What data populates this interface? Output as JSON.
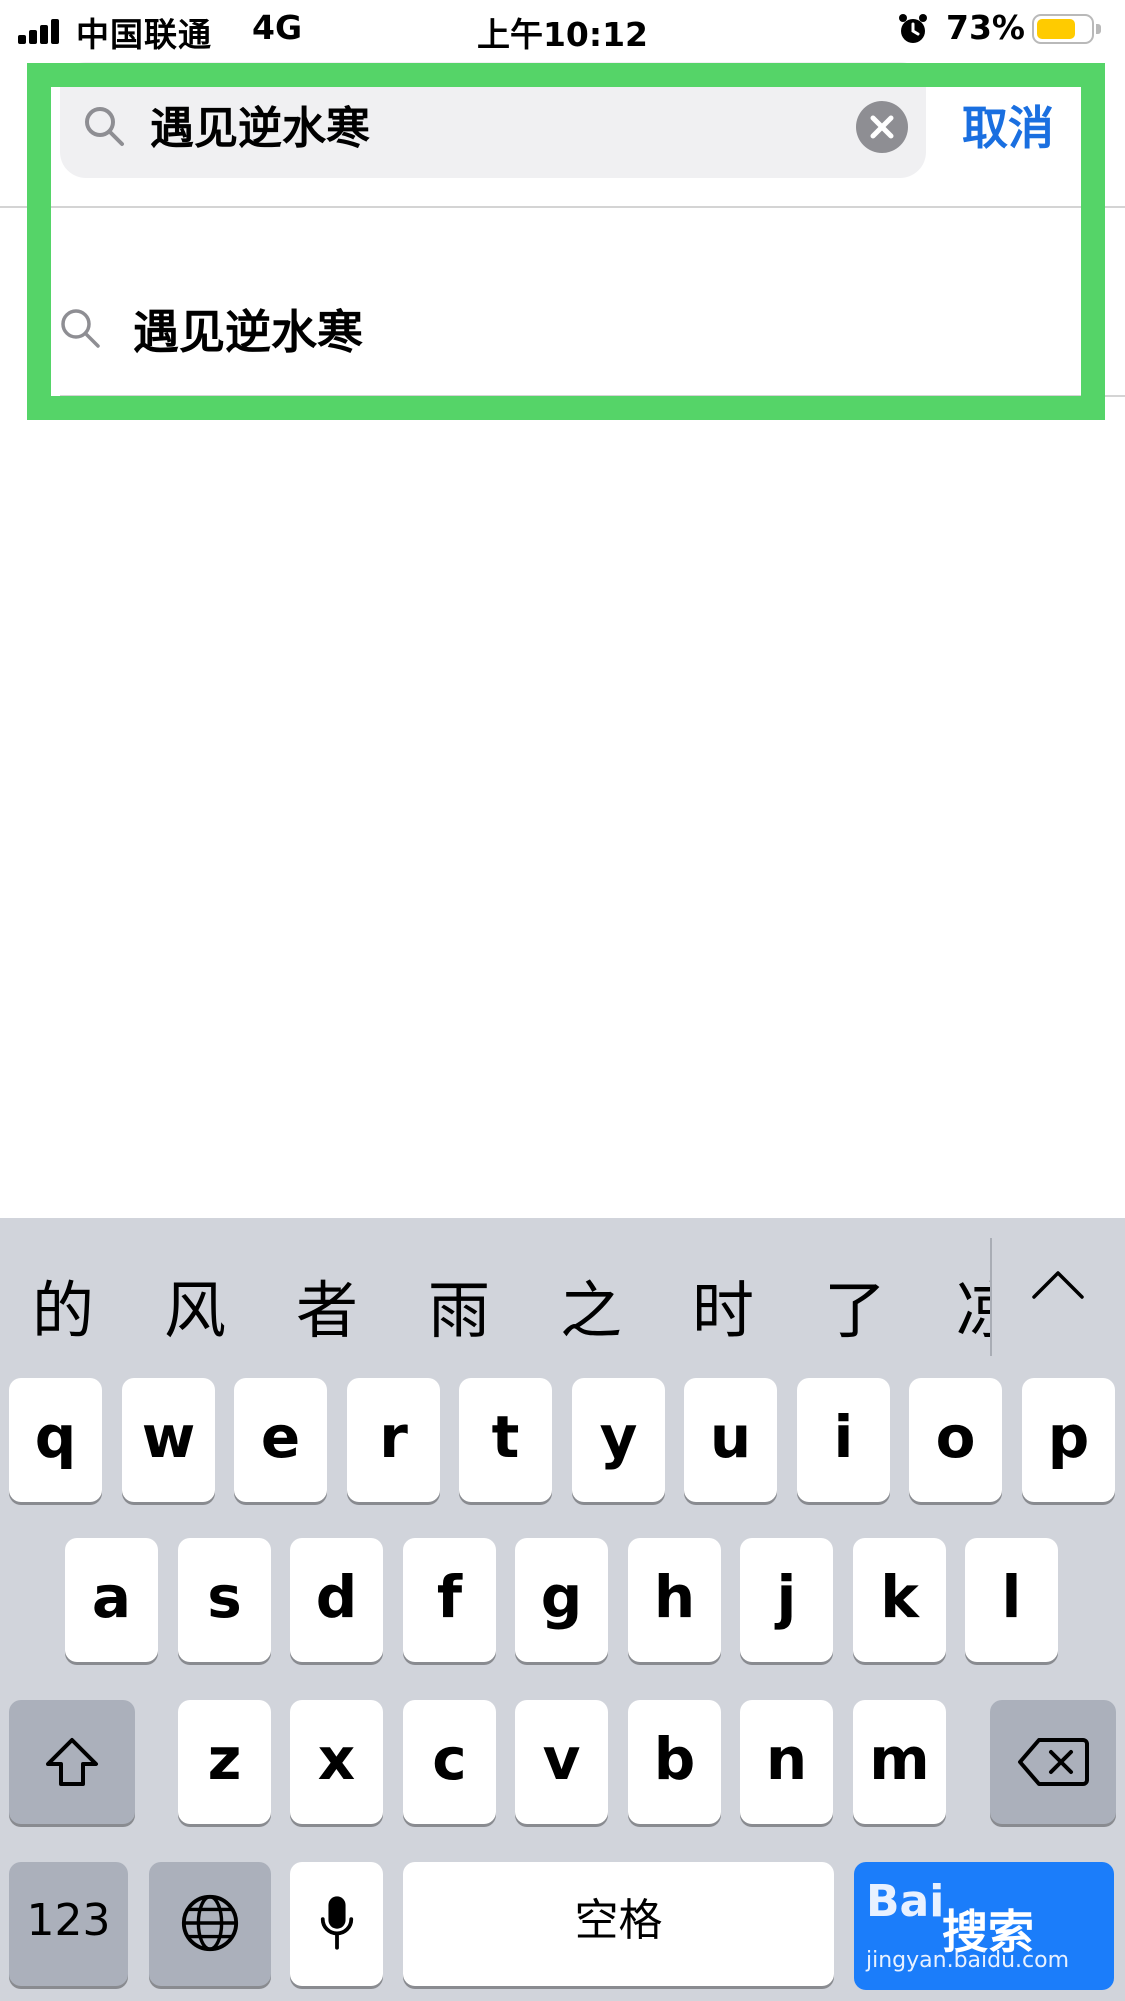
{
  "status_bar": {
    "carrier": "中国联通",
    "network": "4G",
    "time": "上午10:12",
    "battery_percent": "73%",
    "battery_level": 0.73,
    "battery_color": "#ffcb00",
    "icons": [
      "signal-icon",
      "alarm-icon",
      "battery-icon"
    ]
  },
  "search": {
    "query": "遇见逆水寒",
    "cancel_label": "取消",
    "icons": [
      "search-icon",
      "clear-icon"
    ]
  },
  "suggestions": [
    {
      "text": "遇见逆水寒",
      "icon": "search-icon"
    }
  ],
  "highlight_color": "#55d468",
  "keyboard": {
    "candidates": [
      "的",
      "风",
      "者",
      "雨",
      "之",
      "时",
      "了",
      "凉"
    ],
    "row1": [
      "q",
      "w",
      "e",
      "r",
      "t",
      "y",
      "u",
      "i",
      "o",
      "p"
    ],
    "row2": [
      "a",
      "s",
      "d",
      "f",
      "g",
      "h",
      "j",
      "k",
      "l"
    ],
    "row3": [
      "z",
      "x",
      "c",
      "v",
      "b",
      "n",
      "m"
    ],
    "numbers_label": "123",
    "space_label": "空格",
    "icons": [
      "expand-candidates-icon",
      "shift-icon",
      "delete-icon",
      "globe-icon",
      "microphone-icon"
    ],
    "return_watermark": {
      "line1": "Bai",
      "line2": "搜索",
      "line3": "jingyan.baidu.com"
    },
    "accent_color": "#1b7dfa"
  }
}
